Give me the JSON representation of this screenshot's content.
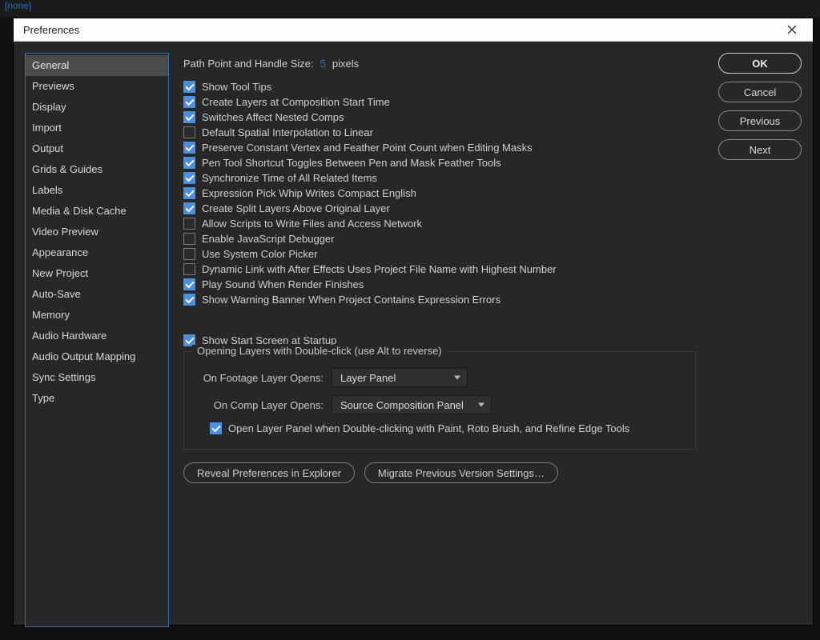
{
  "topfrag": {
    "none": "[none]"
  },
  "dialog": {
    "title": "Preferences"
  },
  "sidebar": {
    "items": [
      "General",
      "Previews",
      "Display",
      "Import",
      "Output",
      "Grids & Guides",
      "Labels",
      "Media & Disk Cache",
      "Video Preview",
      "Appearance",
      "New Project",
      "Auto-Save",
      "Memory",
      "Audio Hardware",
      "Audio Output Mapping",
      "Sync Settings",
      "Type"
    ],
    "selectedIndex": 0
  },
  "buttons": {
    "ok": "OK",
    "cancel": "Cancel",
    "previous": "Previous",
    "next": "Next"
  },
  "path": {
    "label": "Path Point and Handle Size:",
    "value": "5",
    "unit": "pixels"
  },
  "checks": [
    {
      "label": "Show Tool Tips",
      "checked": true
    },
    {
      "label": "Create Layers at Composition Start Time",
      "checked": true
    },
    {
      "label": "Switches Affect Nested Comps",
      "checked": true
    },
    {
      "label": "Default Spatial Interpolation to Linear",
      "checked": false
    },
    {
      "label": "Preserve Constant Vertex and Feather Point Count when Editing Masks",
      "checked": true
    },
    {
      "label": "Pen Tool Shortcut Toggles Between Pen and Mask Feather Tools",
      "checked": true
    },
    {
      "label": "Synchronize Time of All Related Items",
      "checked": true
    },
    {
      "label": "Expression Pick Whip Writes Compact English",
      "checked": true
    },
    {
      "label": "Create Split Layers Above Original Layer",
      "checked": true
    },
    {
      "label": "Allow Scripts to Write Files and Access Network",
      "checked": false
    },
    {
      "label": "Enable JavaScript Debugger",
      "checked": false
    },
    {
      "label": "Use System Color Picker",
      "checked": false
    },
    {
      "label": "Dynamic Link with After Effects Uses Project File Name with Highest Number",
      "checked": false
    },
    {
      "label": "Play Sound When Render Finishes",
      "checked": true
    },
    {
      "label": "Show Warning Banner When Project Contains Expression Errors",
      "checked": true
    }
  ],
  "start_screen": {
    "label": "Show Start Screen at Startup",
    "checked": true
  },
  "dblclick": {
    "legend": "Opening Layers with Double-click (use Alt to reverse)",
    "footage_label": "On Footage Layer Opens:",
    "footage_value": "Layer Panel",
    "comp_label": "On Comp Layer Opens:",
    "comp_value": "Source Composition Panel",
    "open_layer_panel": {
      "label": "Open Layer Panel when Double-clicking with Paint, Roto Brush, and Refine Edge Tools",
      "checked": true
    }
  },
  "bottom": {
    "reveal": "Reveal Preferences in Explorer",
    "migrate": "Migrate Previous Version Settings…"
  }
}
